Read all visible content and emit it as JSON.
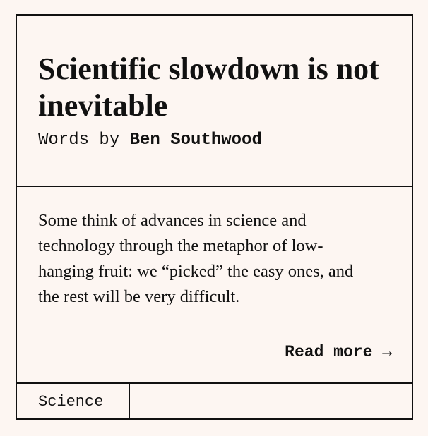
{
  "article": {
    "title": "Scientific slowdown is not inevitable",
    "byline_prefix": "Words by ",
    "author": "Ben Southwood",
    "excerpt": "Some think of advances in science and technology through the metaphor of low-hanging fruit: we “picked” the easy ones, and the rest will be very difficult.",
    "read_more_label": "Read more →",
    "category": "Science"
  },
  "colors": {
    "background": "#fdf6f2",
    "ink": "#111111"
  }
}
